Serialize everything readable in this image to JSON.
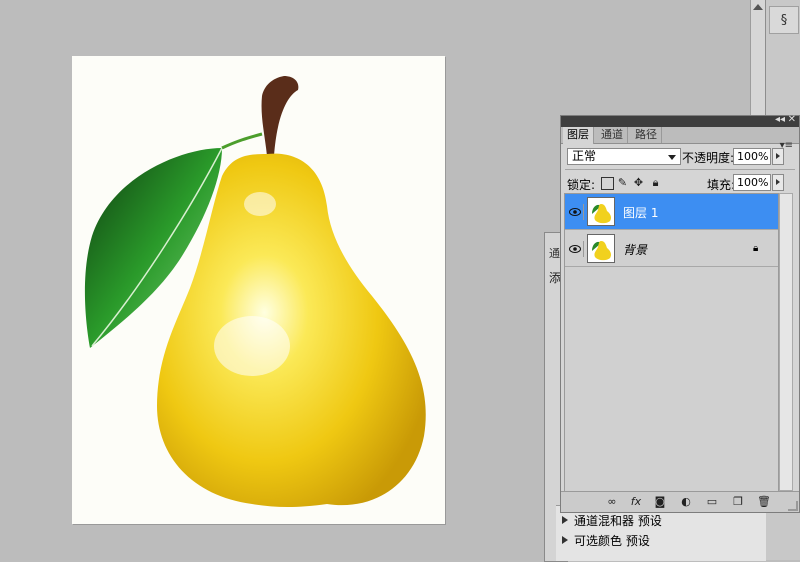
{
  "layers_panel": {
    "tabs": [
      "图层",
      "通道",
      "路径"
    ],
    "active_tab": "图层",
    "blend_mode": "正常",
    "opacity_label": "不透明度:",
    "opacity_value": "100%",
    "lock_label": "锁定:",
    "fill_label": "填充:",
    "fill_value": "100%",
    "layers": [
      {
        "name": "图层 1",
        "selected": true,
        "locked": false
      },
      {
        "name": "背景",
        "selected": false,
        "locked": true
      }
    ]
  },
  "back_panel": {
    "tab_fragment": "通",
    "label_fragment": "添",
    "rows": [
      "通道混和器 预设",
      "可选颜色 预设"
    ]
  },
  "icons": {
    "dock": "history-icon",
    "lock_transparent": "lock-transparency-icon",
    "lock_paint": "brush-icon",
    "lock_move": "move-icon",
    "lock_all": "lock-icon",
    "bottom": [
      "link-icon",
      "fx-icon",
      "mask-icon",
      "adjustment-icon",
      "folder-icon",
      "new-layer-icon",
      "trash-icon"
    ]
  },
  "colors": {
    "selected_layer": "#3d8ef2",
    "pear": "#f2d21c",
    "leaf": "#1f7a1f"
  }
}
